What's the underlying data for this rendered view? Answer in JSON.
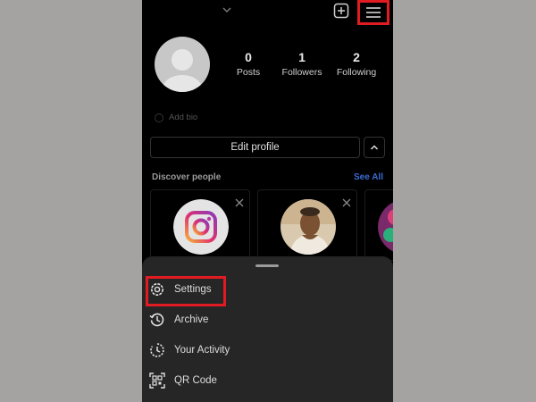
{
  "header": {
    "add_icon": "plus-square-icon",
    "menu_icon": "hamburger-menu-icon",
    "dropdown_icon": "chevron-down-icon"
  },
  "profile": {
    "stats": [
      {
        "value": "0",
        "label": "Posts"
      },
      {
        "value": "1",
        "label": "Followers"
      },
      {
        "value": "2",
        "label": "Following"
      }
    ],
    "add_bio": "Add bio",
    "edit_profile": "Edit profile"
  },
  "discover": {
    "title": "Discover people",
    "see_all": "See All"
  },
  "menu": {
    "items": [
      {
        "label": "Settings",
        "icon": "gear-icon"
      },
      {
        "label": "Archive",
        "icon": "archive-history-icon"
      },
      {
        "label": "Your Activity",
        "icon": "activity-icon"
      },
      {
        "label": "QR Code",
        "icon": "qr-code-icon"
      }
    ]
  },
  "colors": {
    "highlight": "#e11b22",
    "link": "#3b6bd4",
    "sheet": "#262626"
  }
}
